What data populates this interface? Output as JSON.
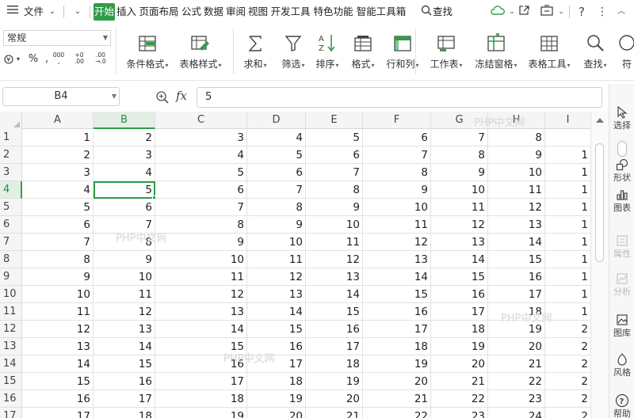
{
  "menubar": {
    "file_menu": "文件",
    "tabs": [
      "开始",
      "插入",
      "页面布局",
      "公式",
      "数据",
      "审阅",
      "视图",
      "开发工具",
      "特色功能",
      "智能工具箱"
    ],
    "active_tab": "开始",
    "search_label": "查找"
  },
  "ribbon": {
    "number_format": "常规",
    "percent": "%",
    "comma": ",",
    "thousands": "000",
    "inc_decimal_top": "+0",
    "inc_decimal_bottom": ".00",
    "dec_decimal_top": ".00",
    "dec_decimal_bottom": "→.0",
    "buttons": [
      {
        "label": "条件格式",
        "icon": "conditional-format-icon"
      },
      {
        "label": "表格样式",
        "icon": "table-style-icon"
      },
      {
        "label": "求和",
        "icon": "sum-icon"
      },
      {
        "label": "筛选",
        "icon": "filter-icon"
      },
      {
        "label": "排序",
        "icon": "sort-icon"
      },
      {
        "label": "格式",
        "icon": "format-icon"
      },
      {
        "label": "行和列",
        "icon": "rows-columns-icon"
      },
      {
        "label": "工作表",
        "icon": "worksheet-icon"
      },
      {
        "label": "冻结窗格",
        "icon": "freeze-panes-icon"
      },
      {
        "label": "表格工具",
        "icon": "table-tools-icon"
      },
      {
        "label": "查找",
        "icon": "find-icon"
      },
      {
        "label": "符",
        "icon": "symbol-icon"
      }
    ]
  },
  "formula_bar": {
    "name_box": "B4",
    "fx_label": "fx",
    "value": "5"
  },
  "sheet": {
    "columns": [
      "A",
      "B",
      "C",
      "D",
      "E",
      "F",
      "G",
      "H",
      "I"
    ],
    "selected_column": "B",
    "selected_row": "4",
    "rows": [
      {
        "num": "1",
        "cells": [
          "1",
          "2",
          "3",
          "4",
          "5",
          "6",
          "7",
          "8",
          ""
        ]
      },
      {
        "num": "2",
        "cells": [
          "2",
          "3",
          "4",
          "5",
          "6",
          "7",
          "8",
          "9",
          "1"
        ]
      },
      {
        "num": "3",
        "cells": [
          "3",
          "4",
          "5",
          "6",
          "7",
          "8",
          "9",
          "10",
          "1"
        ]
      },
      {
        "num": "4",
        "cells": [
          "4",
          "5",
          "6",
          "7",
          "8",
          "9",
          "10",
          "11",
          "1"
        ]
      },
      {
        "num": "5",
        "cells": [
          "5",
          "6",
          "7",
          "8",
          "9",
          "10",
          "11",
          "12",
          "1"
        ]
      },
      {
        "num": "6",
        "cells": [
          "6",
          "7",
          "8",
          "9",
          "10",
          "11",
          "12",
          "13",
          "1"
        ]
      },
      {
        "num": "7",
        "cells": [
          "7",
          "8",
          "9",
          "10",
          "11",
          "12",
          "13",
          "14",
          "1"
        ]
      },
      {
        "num": "8",
        "cells": [
          "8",
          "9",
          "10",
          "11",
          "12",
          "13",
          "14",
          "15",
          "1"
        ]
      },
      {
        "num": "9",
        "cells": [
          "9",
          "10",
          "11",
          "12",
          "13",
          "14",
          "15",
          "16",
          "1"
        ]
      },
      {
        "num": "10",
        "cells": [
          "10",
          "11",
          "12",
          "13",
          "14",
          "15",
          "16",
          "17",
          "1"
        ]
      },
      {
        "num": "11",
        "cells": [
          "11",
          "12",
          "13",
          "14",
          "15",
          "16",
          "17",
          "18",
          "1"
        ]
      },
      {
        "num": "12",
        "cells": [
          "12",
          "13",
          "14",
          "15",
          "16",
          "17",
          "18",
          "19",
          "2"
        ]
      },
      {
        "num": "13",
        "cells": [
          "13",
          "14",
          "15",
          "16",
          "17",
          "18",
          "19",
          "20",
          "2"
        ]
      },
      {
        "num": "14",
        "cells": [
          "14",
          "15",
          "16",
          "17",
          "18",
          "19",
          "20",
          "21",
          "2"
        ]
      },
      {
        "num": "15",
        "cells": [
          "15",
          "16",
          "17",
          "18",
          "19",
          "20",
          "21",
          "22",
          "2"
        ]
      },
      {
        "num": "16",
        "cells": [
          "16",
          "17",
          "18",
          "19",
          "20",
          "21",
          "22",
          "23",
          "2"
        ]
      },
      {
        "num": "17",
        "cells": [
          "17",
          "18",
          "19",
          "20",
          "21",
          "22",
          "23",
          "24",
          "2"
        ]
      }
    ]
  },
  "watermark_text": "PHP中文网",
  "side_panel": {
    "items": [
      {
        "label": "选择",
        "icon": "cursor-icon",
        "disabled": false
      },
      {
        "label": "形状",
        "icon": "shapes-icon",
        "disabled": false
      },
      {
        "label": "图表",
        "icon": "chart-icon",
        "disabled": false
      },
      {
        "label": "属性",
        "icon": "properties-icon",
        "disabled": true
      },
      {
        "label": "分析",
        "icon": "analysis-icon",
        "disabled": true
      },
      {
        "label": "图库",
        "icon": "gallery-icon",
        "disabled": false
      },
      {
        "label": "风格",
        "icon": "style-icon",
        "disabled": false
      },
      {
        "label": "帮助",
        "icon": "help-icon",
        "disabled": false
      }
    ]
  },
  "colors": {
    "accent": "#2f9d4a",
    "selected_header_bg": "#e3efe5",
    "grid_line": "#e2e2e2",
    "header_bg": "#f5f5f5"
  }
}
